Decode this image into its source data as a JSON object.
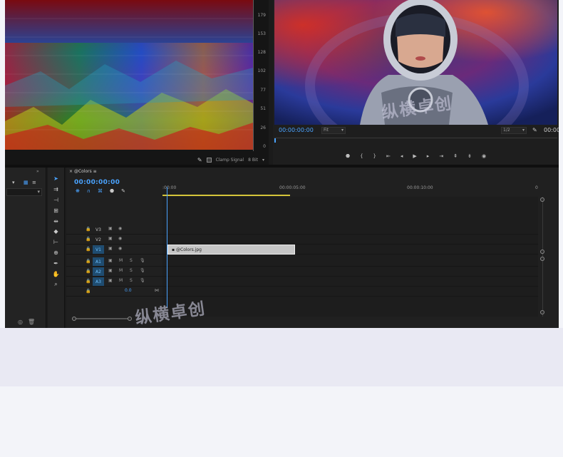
{
  "scope": {
    "scale_labels": [
      "179",
      "153",
      "128",
      "102",
      "77",
      "51",
      "26",
      "0"
    ],
    "clamp_signal_label": "Clamp Signal",
    "bit_depth_label": "8 Bit"
  },
  "program_monitor": {
    "timecode_left": "00:00:00:00",
    "zoom_value": "Fit",
    "resolution_value": "1/2",
    "timecode_right": "00:00"
  },
  "timeline": {
    "sequence_name": "@Colors",
    "current_timecode": "00:00:00:00",
    "ruler_times": [
      ":00:00",
      "00:00:05:00",
      "00:00:10:00"
    ],
    "video_tracks": [
      "V3",
      "V2",
      "V1"
    ],
    "audio_tracks": [
      "A1",
      "A2",
      "A3"
    ],
    "master_level": "0.0",
    "clip_name": "@Colors.jpg"
  },
  "watermark_text": "纵横卓创",
  "colors": {
    "accent_blue": "#4aa3ff",
    "clip_gray": "#c6c6c6",
    "panel_bg": "#1b1b1b",
    "page_bg": "#f3f4f9"
  }
}
